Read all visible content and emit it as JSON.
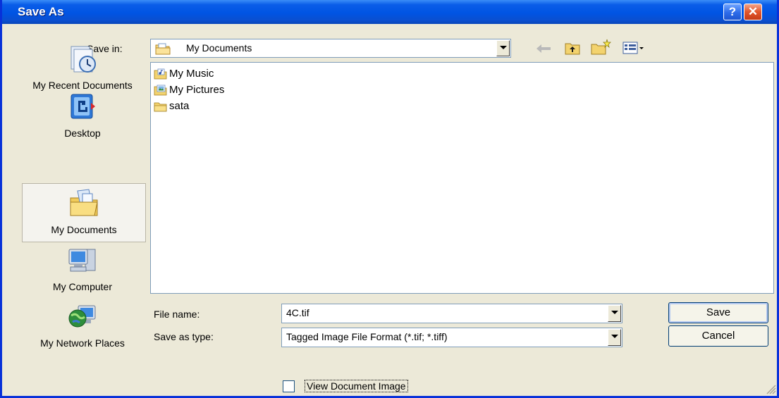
{
  "window": {
    "title": "Save As"
  },
  "titlebar": {
    "help_label": "?",
    "close_label": "✕"
  },
  "save_in": {
    "label": "Save in:",
    "value": "My Documents"
  },
  "toolbar": {
    "icons": [
      "back-arrow-icon",
      "up-folder-icon",
      "new-folder-icon",
      "views-menu-icon"
    ]
  },
  "places": [
    {
      "label": "My Recent Documents",
      "icon": "recent-documents-icon"
    },
    {
      "label": "Desktop",
      "icon": "desktop-icon"
    },
    {
      "label": "My Documents",
      "icon": "my-documents-icon",
      "selected": true
    },
    {
      "label": "My Computer",
      "icon": "my-computer-icon"
    },
    {
      "label": "My Network Places",
      "icon": "network-places-icon"
    }
  ],
  "files": [
    {
      "name": "My Music",
      "icon": "music-folder-icon"
    },
    {
      "name": "My Pictures",
      "icon": "pictures-folder-icon"
    },
    {
      "name": "sata",
      "icon": "folder-icon"
    }
  ],
  "file_name": {
    "label": "File name:",
    "value": "4C.tif"
  },
  "save_as_type": {
    "label": "Save as type:",
    "value": "Tagged Image File Format (*.tif; *.tiff)"
  },
  "buttons": {
    "save": "Save",
    "cancel": "Cancel"
  },
  "options": {
    "view_document_image": {
      "label": "View Document Image",
      "checked": false
    }
  },
  "colors": {
    "titlebar": "#0054E3",
    "dialog_bg": "#ECE9D8",
    "border": "#0831D9",
    "close_button": "#E2552B"
  }
}
